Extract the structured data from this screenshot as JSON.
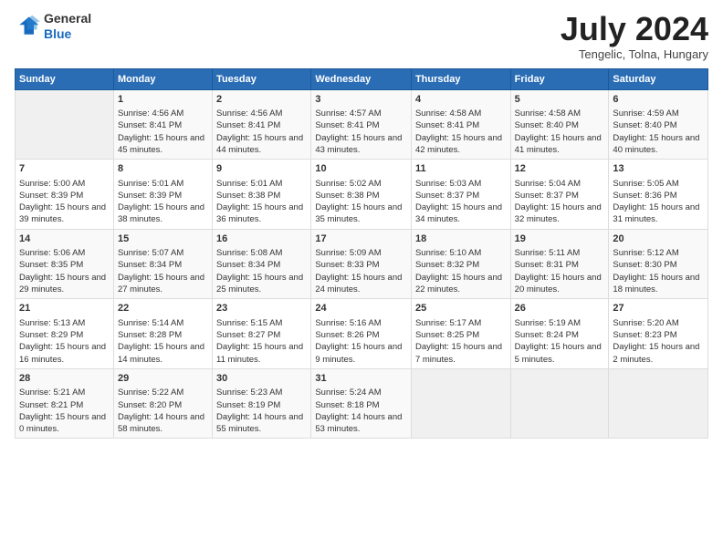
{
  "logo": {
    "general": "General",
    "blue": "Blue"
  },
  "header": {
    "month": "July 2024",
    "location": "Tengelic, Tolna, Hungary"
  },
  "columns": [
    "Sunday",
    "Monday",
    "Tuesday",
    "Wednesday",
    "Thursday",
    "Friday",
    "Saturday"
  ],
  "weeks": [
    [
      {
        "day": "",
        "sunrise": "",
        "sunset": "",
        "daylight": ""
      },
      {
        "day": "1",
        "sunrise": "Sunrise: 4:56 AM",
        "sunset": "Sunset: 8:41 PM",
        "daylight": "Daylight: 15 hours and 45 minutes."
      },
      {
        "day": "2",
        "sunrise": "Sunrise: 4:56 AM",
        "sunset": "Sunset: 8:41 PM",
        "daylight": "Daylight: 15 hours and 44 minutes."
      },
      {
        "day": "3",
        "sunrise": "Sunrise: 4:57 AM",
        "sunset": "Sunset: 8:41 PM",
        "daylight": "Daylight: 15 hours and 43 minutes."
      },
      {
        "day": "4",
        "sunrise": "Sunrise: 4:58 AM",
        "sunset": "Sunset: 8:41 PM",
        "daylight": "Daylight: 15 hours and 42 minutes."
      },
      {
        "day": "5",
        "sunrise": "Sunrise: 4:58 AM",
        "sunset": "Sunset: 8:40 PM",
        "daylight": "Daylight: 15 hours and 41 minutes."
      },
      {
        "day": "6",
        "sunrise": "Sunrise: 4:59 AM",
        "sunset": "Sunset: 8:40 PM",
        "daylight": "Daylight: 15 hours and 40 minutes."
      }
    ],
    [
      {
        "day": "7",
        "sunrise": "Sunrise: 5:00 AM",
        "sunset": "Sunset: 8:39 PM",
        "daylight": "Daylight: 15 hours and 39 minutes."
      },
      {
        "day": "8",
        "sunrise": "Sunrise: 5:01 AM",
        "sunset": "Sunset: 8:39 PM",
        "daylight": "Daylight: 15 hours and 38 minutes."
      },
      {
        "day": "9",
        "sunrise": "Sunrise: 5:01 AM",
        "sunset": "Sunset: 8:38 PM",
        "daylight": "Daylight: 15 hours and 36 minutes."
      },
      {
        "day": "10",
        "sunrise": "Sunrise: 5:02 AM",
        "sunset": "Sunset: 8:38 PM",
        "daylight": "Daylight: 15 hours and 35 minutes."
      },
      {
        "day": "11",
        "sunrise": "Sunrise: 5:03 AM",
        "sunset": "Sunset: 8:37 PM",
        "daylight": "Daylight: 15 hours and 34 minutes."
      },
      {
        "day": "12",
        "sunrise": "Sunrise: 5:04 AM",
        "sunset": "Sunset: 8:37 PM",
        "daylight": "Daylight: 15 hours and 32 minutes."
      },
      {
        "day": "13",
        "sunrise": "Sunrise: 5:05 AM",
        "sunset": "Sunset: 8:36 PM",
        "daylight": "Daylight: 15 hours and 31 minutes."
      }
    ],
    [
      {
        "day": "14",
        "sunrise": "Sunrise: 5:06 AM",
        "sunset": "Sunset: 8:35 PM",
        "daylight": "Daylight: 15 hours and 29 minutes."
      },
      {
        "day": "15",
        "sunrise": "Sunrise: 5:07 AM",
        "sunset": "Sunset: 8:34 PM",
        "daylight": "Daylight: 15 hours and 27 minutes."
      },
      {
        "day": "16",
        "sunrise": "Sunrise: 5:08 AM",
        "sunset": "Sunset: 8:34 PM",
        "daylight": "Daylight: 15 hours and 25 minutes."
      },
      {
        "day": "17",
        "sunrise": "Sunrise: 5:09 AM",
        "sunset": "Sunset: 8:33 PM",
        "daylight": "Daylight: 15 hours and 24 minutes."
      },
      {
        "day": "18",
        "sunrise": "Sunrise: 5:10 AM",
        "sunset": "Sunset: 8:32 PM",
        "daylight": "Daylight: 15 hours and 22 minutes."
      },
      {
        "day": "19",
        "sunrise": "Sunrise: 5:11 AM",
        "sunset": "Sunset: 8:31 PM",
        "daylight": "Daylight: 15 hours and 20 minutes."
      },
      {
        "day": "20",
        "sunrise": "Sunrise: 5:12 AM",
        "sunset": "Sunset: 8:30 PM",
        "daylight": "Daylight: 15 hours and 18 minutes."
      }
    ],
    [
      {
        "day": "21",
        "sunrise": "Sunrise: 5:13 AM",
        "sunset": "Sunset: 8:29 PM",
        "daylight": "Daylight: 15 hours and 16 minutes."
      },
      {
        "day": "22",
        "sunrise": "Sunrise: 5:14 AM",
        "sunset": "Sunset: 8:28 PM",
        "daylight": "Daylight: 15 hours and 14 minutes."
      },
      {
        "day": "23",
        "sunrise": "Sunrise: 5:15 AM",
        "sunset": "Sunset: 8:27 PM",
        "daylight": "Daylight: 15 hours and 11 minutes."
      },
      {
        "day": "24",
        "sunrise": "Sunrise: 5:16 AM",
        "sunset": "Sunset: 8:26 PM",
        "daylight": "Daylight: 15 hours and 9 minutes."
      },
      {
        "day": "25",
        "sunrise": "Sunrise: 5:17 AM",
        "sunset": "Sunset: 8:25 PM",
        "daylight": "Daylight: 15 hours and 7 minutes."
      },
      {
        "day": "26",
        "sunrise": "Sunrise: 5:19 AM",
        "sunset": "Sunset: 8:24 PM",
        "daylight": "Daylight: 15 hours and 5 minutes."
      },
      {
        "day": "27",
        "sunrise": "Sunrise: 5:20 AM",
        "sunset": "Sunset: 8:23 PM",
        "daylight": "Daylight: 15 hours and 2 minutes."
      }
    ],
    [
      {
        "day": "28",
        "sunrise": "Sunrise: 5:21 AM",
        "sunset": "Sunset: 8:21 PM",
        "daylight": "Daylight: 15 hours and 0 minutes."
      },
      {
        "day": "29",
        "sunrise": "Sunrise: 5:22 AM",
        "sunset": "Sunset: 8:20 PM",
        "daylight": "Daylight: 14 hours and 58 minutes."
      },
      {
        "day": "30",
        "sunrise": "Sunrise: 5:23 AM",
        "sunset": "Sunset: 8:19 PM",
        "daylight": "Daylight: 14 hours and 55 minutes."
      },
      {
        "day": "31",
        "sunrise": "Sunrise: 5:24 AM",
        "sunset": "Sunset: 8:18 PM",
        "daylight": "Daylight: 14 hours and 53 minutes."
      },
      {
        "day": "",
        "sunrise": "",
        "sunset": "",
        "daylight": ""
      },
      {
        "day": "",
        "sunrise": "",
        "sunset": "",
        "daylight": ""
      },
      {
        "day": "",
        "sunrise": "",
        "sunset": "",
        "daylight": ""
      }
    ]
  ]
}
